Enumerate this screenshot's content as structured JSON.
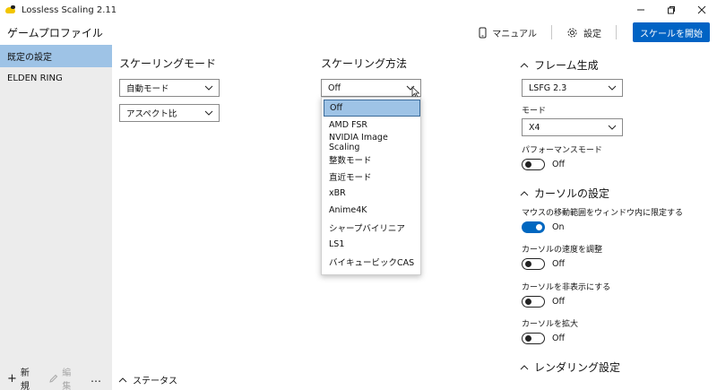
{
  "window": {
    "title": "Lossless Scaling 2.11"
  },
  "header": {
    "page_title": "ゲームプロファイル",
    "manual_label": "マニュアル",
    "settings_label": "設定",
    "start_button": "スケールを開始"
  },
  "sidebar": {
    "items": [
      {
        "label": "既定の設定",
        "active": true
      },
      {
        "label": "ELDEN RING",
        "active": false
      }
    ],
    "new_label": "新規",
    "edit_label": "編集",
    "more_label": "…"
  },
  "scaling_mode": {
    "heading": "スケーリングモード",
    "mode_value": "自動モード",
    "aspect_value": "アスペクト比"
  },
  "scaling_method": {
    "heading": "スケーリング方法",
    "selected_value": "Off",
    "options": [
      "Off",
      "AMD FSR",
      "NVIDIA Image Scaling",
      "整数モード",
      "直近モード",
      "xBR",
      "Anime4K",
      "シャープバイリニア",
      "LS1",
      "バイキュービックCAS"
    ]
  },
  "frame_gen": {
    "heading": "フレーム生成",
    "version_value": "LSFG 2.3",
    "mode_label": "モード",
    "mode_value": "X4",
    "perf_label": "パフォーマンスモード",
    "perf_state": "Off"
  },
  "cursor": {
    "heading": "カーソルの設定",
    "clip_label": "マウスの移動範囲をウィンドウ内に限定する",
    "clip_state": "On",
    "speed_label": "カーソルの速度を調整",
    "speed_state": "Off",
    "hide_label": "カーソルを非表示にする",
    "hide_state": "Off",
    "scale_label": "カーソルを拡大",
    "scale_state": "Off"
  },
  "rendering": {
    "heading": "レンダリング設定"
  },
  "status": {
    "label": "ステータス"
  },
  "colors": {
    "accent": "#0063c4",
    "selection": "#9ec3e6",
    "sidebar_bg": "#ececec"
  }
}
